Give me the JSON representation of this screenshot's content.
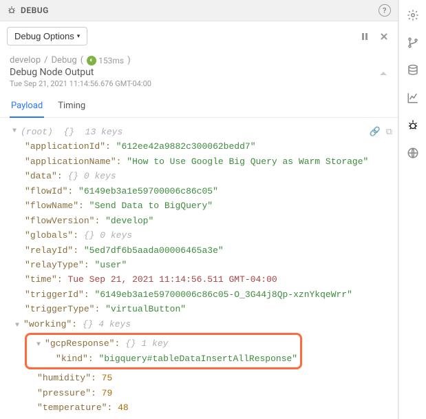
{
  "header": {
    "title": "DEBUG"
  },
  "toolbar": {
    "debug_options": "Debug Options"
  },
  "breadcrumb": {
    "app": "develop",
    "node": "Debug",
    "ms": "153ms"
  },
  "meta": {
    "title": "Debug Node Output",
    "timestamp": "Tue Sep 21, 2021 11:14:56.676 GMT-04:00"
  },
  "tabs": {
    "payload": "Payload",
    "timing": "Timing"
  },
  "root": {
    "label": "(root)",
    "braces": "{}",
    "count": "13 keys"
  },
  "keys": {
    "applicationId": "applicationId",
    "applicationName": "applicationName",
    "data": "data",
    "flowId": "flowId",
    "flowName": "flowName",
    "flowVersion": "flowVersion",
    "globals": "globals",
    "relayId": "relayId",
    "relayType": "relayType",
    "time": "time",
    "triggerId": "triggerId",
    "triggerType": "triggerType",
    "working": "working",
    "gcpResponse": "gcpResponse",
    "kind": "kind",
    "humidity": "humidity",
    "pressure": "pressure",
    "temperature": "temperature"
  },
  "vals": {
    "applicationId": "\"612ee42a9882c300062bedd7\"",
    "applicationName": "\"How to Use Google Big Query as Warm Storage\"",
    "data_meta": "{}  0 keys",
    "flowId": "\"6149eb3a1e59700006c86c05\"",
    "flowName": "\"Send Data to BigQuery\"",
    "flowVersion": "\"develop\"",
    "globals_meta": "{}  0 keys",
    "relayId": "\"5ed7df6b5aada00006465a3e\"",
    "relayType": "\"user\"",
    "time": "Tue Sep 21, 2021 11:14:56.511 GMT-04:00",
    "triggerId": "\"6149eb3a1e59700006c86c05-O_3G44j8Qp-xznYkqeWrr\"",
    "triggerType": "\"virtualButton\"",
    "working_meta": "{}  4 keys",
    "gcpResponse_meta": "{}  1 key",
    "kind": "\"bigquery#tableDataInsertAllResponse\"",
    "humidity": "75",
    "pressure": "79",
    "temperature": "48"
  }
}
